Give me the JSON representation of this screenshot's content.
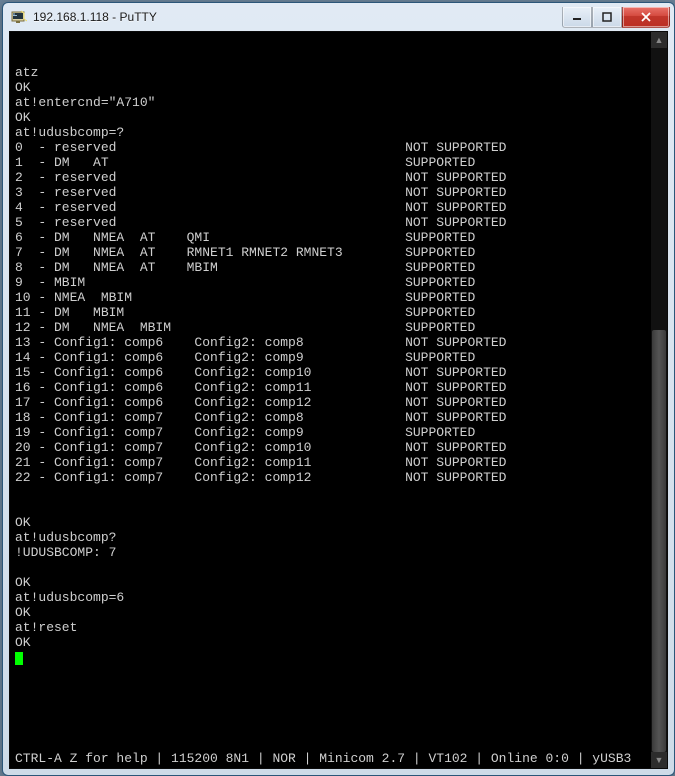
{
  "window": {
    "title": "192.168.1.118 - PuTTY"
  },
  "terminal": {
    "lines": [
      "atz",
      "OK",
      "at!entercnd=\"A710\"",
      "OK",
      "at!udusbcomp=?",
      "0  - reserved                                     NOT SUPPORTED",
      "1  - DM   AT                                      SUPPORTED",
      "2  - reserved                                     NOT SUPPORTED",
      "3  - reserved                                     NOT SUPPORTED",
      "4  - reserved                                     NOT SUPPORTED",
      "5  - reserved                                     NOT SUPPORTED",
      "6  - DM   NMEA  AT    QMI                         SUPPORTED",
      "7  - DM   NMEA  AT    RMNET1 RMNET2 RMNET3        SUPPORTED",
      "8  - DM   NMEA  AT    MBIM                        SUPPORTED",
      "9  - MBIM                                         SUPPORTED",
      "10 - NMEA  MBIM                                   SUPPORTED",
      "11 - DM   MBIM                                    SUPPORTED",
      "12 - DM   NMEA  MBIM                              SUPPORTED",
      "13 - Config1: comp6    Config2: comp8             NOT SUPPORTED",
      "14 - Config1: comp6    Config2: comp9             SUPPORTED",
      "15 - Config1: comp6    Config2: comp10            NOT SUPPORTED",
      "16 - Config1: comp6    Config2: comp11            NOT SUPPORTED",
      "17 - Config1: comp6    Config2: comp12            NOT SUPPORTED",
      "18 - Config1: comp7    Config2: comp8             NOT SUPPORTED",
      "19 - Config1: comp7    Config2: comp9             SUPPORTED",
      "20 - Config1: comp7    Config2: comp10            NOT SUPPORTED",
      "21 - Config1: comp7    Config2: comp11            NOT SUPPORTED",
      "22 - Config1: comp7    Config2: comp12            NOT SUPPORTED",
      "",
      "",
      "OK",
      "at!udusbcomp?",
      "!UDUSBCOMP: 7",
      "",
      "OK",
      "at!udusbcomp=6",
      "OK",
      "at!reset",
      "OK"
    ],
    "statusbar": "CTRL-A Z for help | 115200 8N1 | NOR | Minicom 2.7 | VT102 | Online 0:0 | yUSB3"
  }
}
